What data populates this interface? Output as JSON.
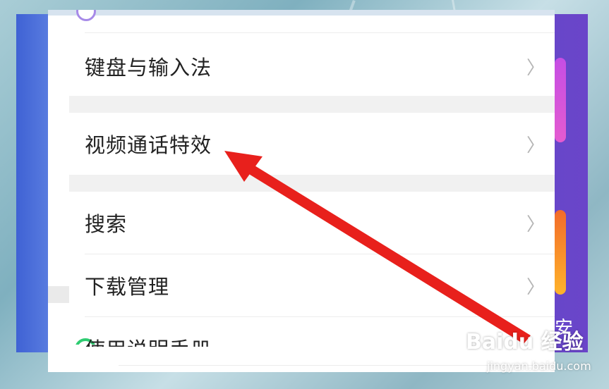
{
  "menu": {
    "items": [
      {
        "label": "键盘与输入法"
      },
      {
        "label": "视频通话特效"
      },
      {
        "label": "搜索"
      },
      {
        "label": "下载管理"
      }
    ],
    "clipped_item": "使用说明手册",
    "chevron": "〉"
  },
  "watermark": {
    "brand": "Baidu 经验",
    "url": "jingyan.baidu.com"
  },
  "side_text": "安",
  "colors": {
    "arrow": "#e8201c",
    "panel": "#ffffff",
    "separator": "#f1f1f1"
  }
}
